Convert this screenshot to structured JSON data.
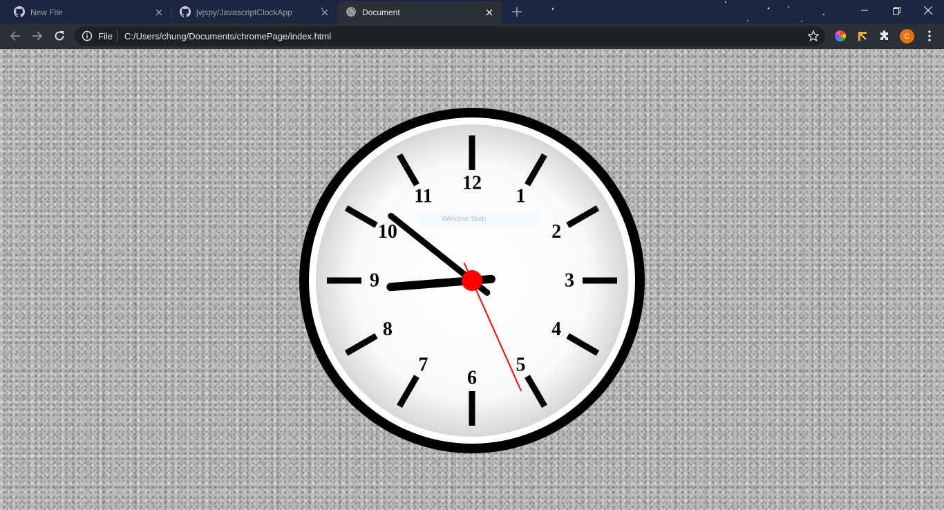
{
  "tabs": [
    {
      "title": "New File",
      "icon": "github-icon",
      "active": false
    },
    {
      "title": "jvjspy/JavascriptClockApp",
      "icon": "github-icon",
      "active": false
    },
    {
      "title": "Document",
      "icon": "globe-icon",
      "active": true
    }
  ],
  "toolbar": {
    "scheme_label": "File",
    "url": "C:/Users/chung/Documents/chromePage/index.html",
    "avatar_letter": "C",
    "avatar_color": "#e8710a"
  },
  "clock": {
    "numbers": [
      "12",
      "1",
      "2",
      "3",
      "4",
      "5",
      "6",
      "7",
      "8",
      "9",
      "10",
      "11"
    ],
    "time": {
      "hours": 8,
      "minutes": 51,
      "seconds": 26
    },
    "second_hand_color": "#ff0000",
    "center_color": "#ff0000",
    "rim_color": "#000000"
  },
  "overlay": {
    "snip_label": "Window Snip"
  }
}
